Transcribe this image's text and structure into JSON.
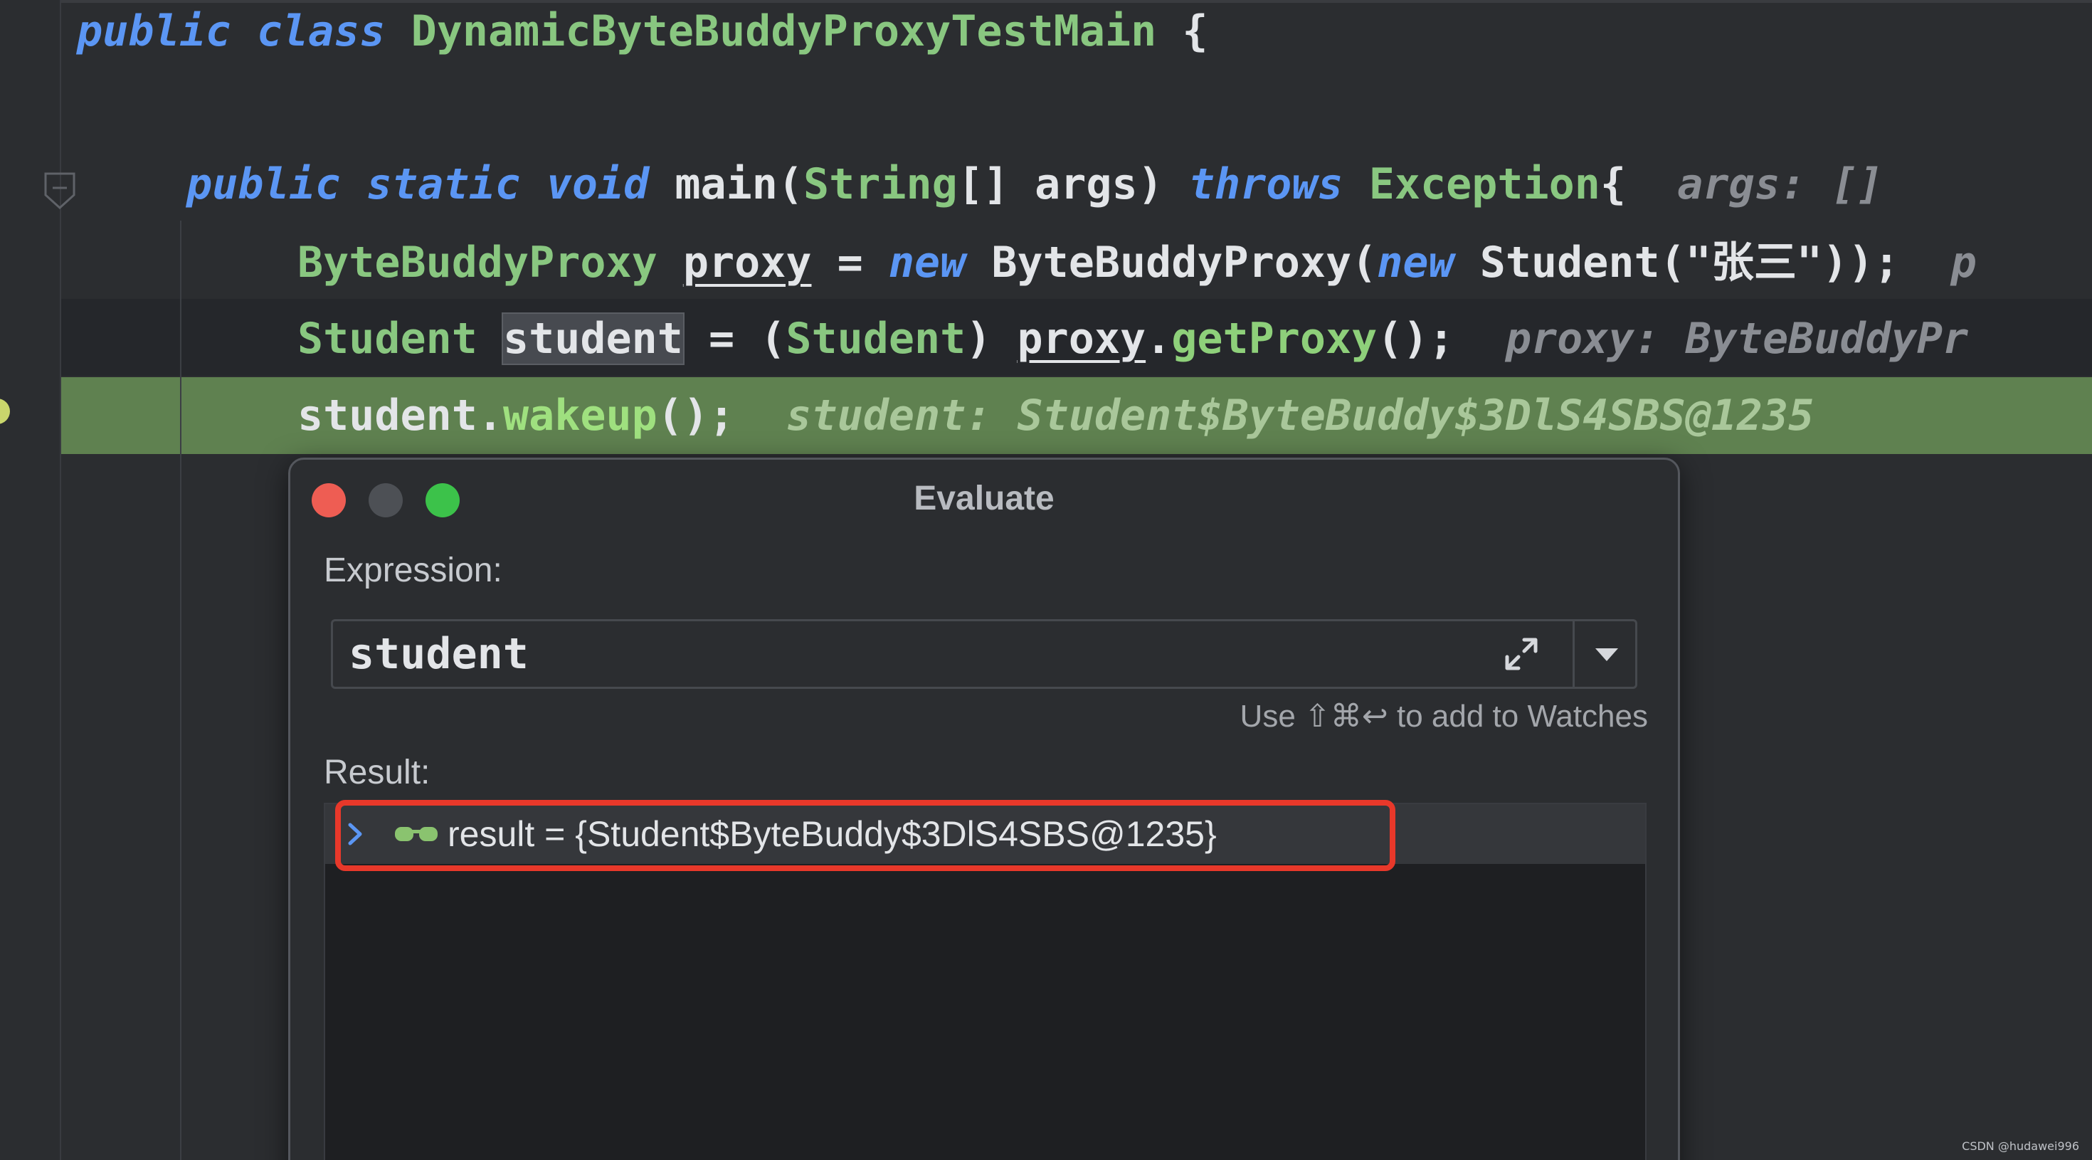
{
  "editor": {
    "line1": {
      "kw1": "public",
      "kw2": "class",
      "classname": "DynamicByteBuddyProxyTestMain",
      "brace": "{"
    },
    "line2": {
      "kw1": "public",
      "kw2": "static",
      "kw3": "void",
      "method": "main",
      "p1": "(",
      "type": "String",
      "arr": "[]",
      "param": "args",
      "p2": ")",
      "kw4": "throws",
      "exc": "Exception",
      "brace": "{",
      "hint": "args: []"
    },
    "line3": {
      "type": "ByteBuddyProxy",
      "var": "proxy",
      "eq": "=",
      "kw": "new",
      "ctor": "ByteBuddyProxy",
      "p1": "(",
      "kw2": "new",
      "ctor2": "Student",
      "args": "(\"张三\"));",
      "hint": "p"
    },
    "line4": {
      "type": "Student",
      "var": "student",
      "eq": "=",
      "cast_open": "(",
      "cast_type": "Student",
      "cast_close": ")",
      "obj": "proxy",
      "dot": ".",
      "call": "getProxy",
      "tail": "();",
      "hint": "proxy: ByteBuddyPr"
    },
    "line5": {
      "obj": "student",
      "dot": ".",
      "call": "wakeup",
      "tail": "();",
      "hint": "student: Student$ByteBuddy$3DlS4SBS@1235"
    }
  },
  "dialog": {
    "title": "Evaluate",
    "expression_label": "Expression:",
    "expression_value": "student",
    "watches_hint": "Use ⇧⌘↩ to add to Watches",
    "result_label": "Result:",
    "result_text": "result = {Student$ByteBuddy$3DlS4SBS@1235}"
  },
  "watermark": "CSDN @hudawei996",
  "colors": {
    "background": "#2b2d30",
    "keyword": "#5b96f4",
    "type": "#89c780",
    "exec_line": "#5f8150",
    "highlight_border": "#e8382a"
  }
}
